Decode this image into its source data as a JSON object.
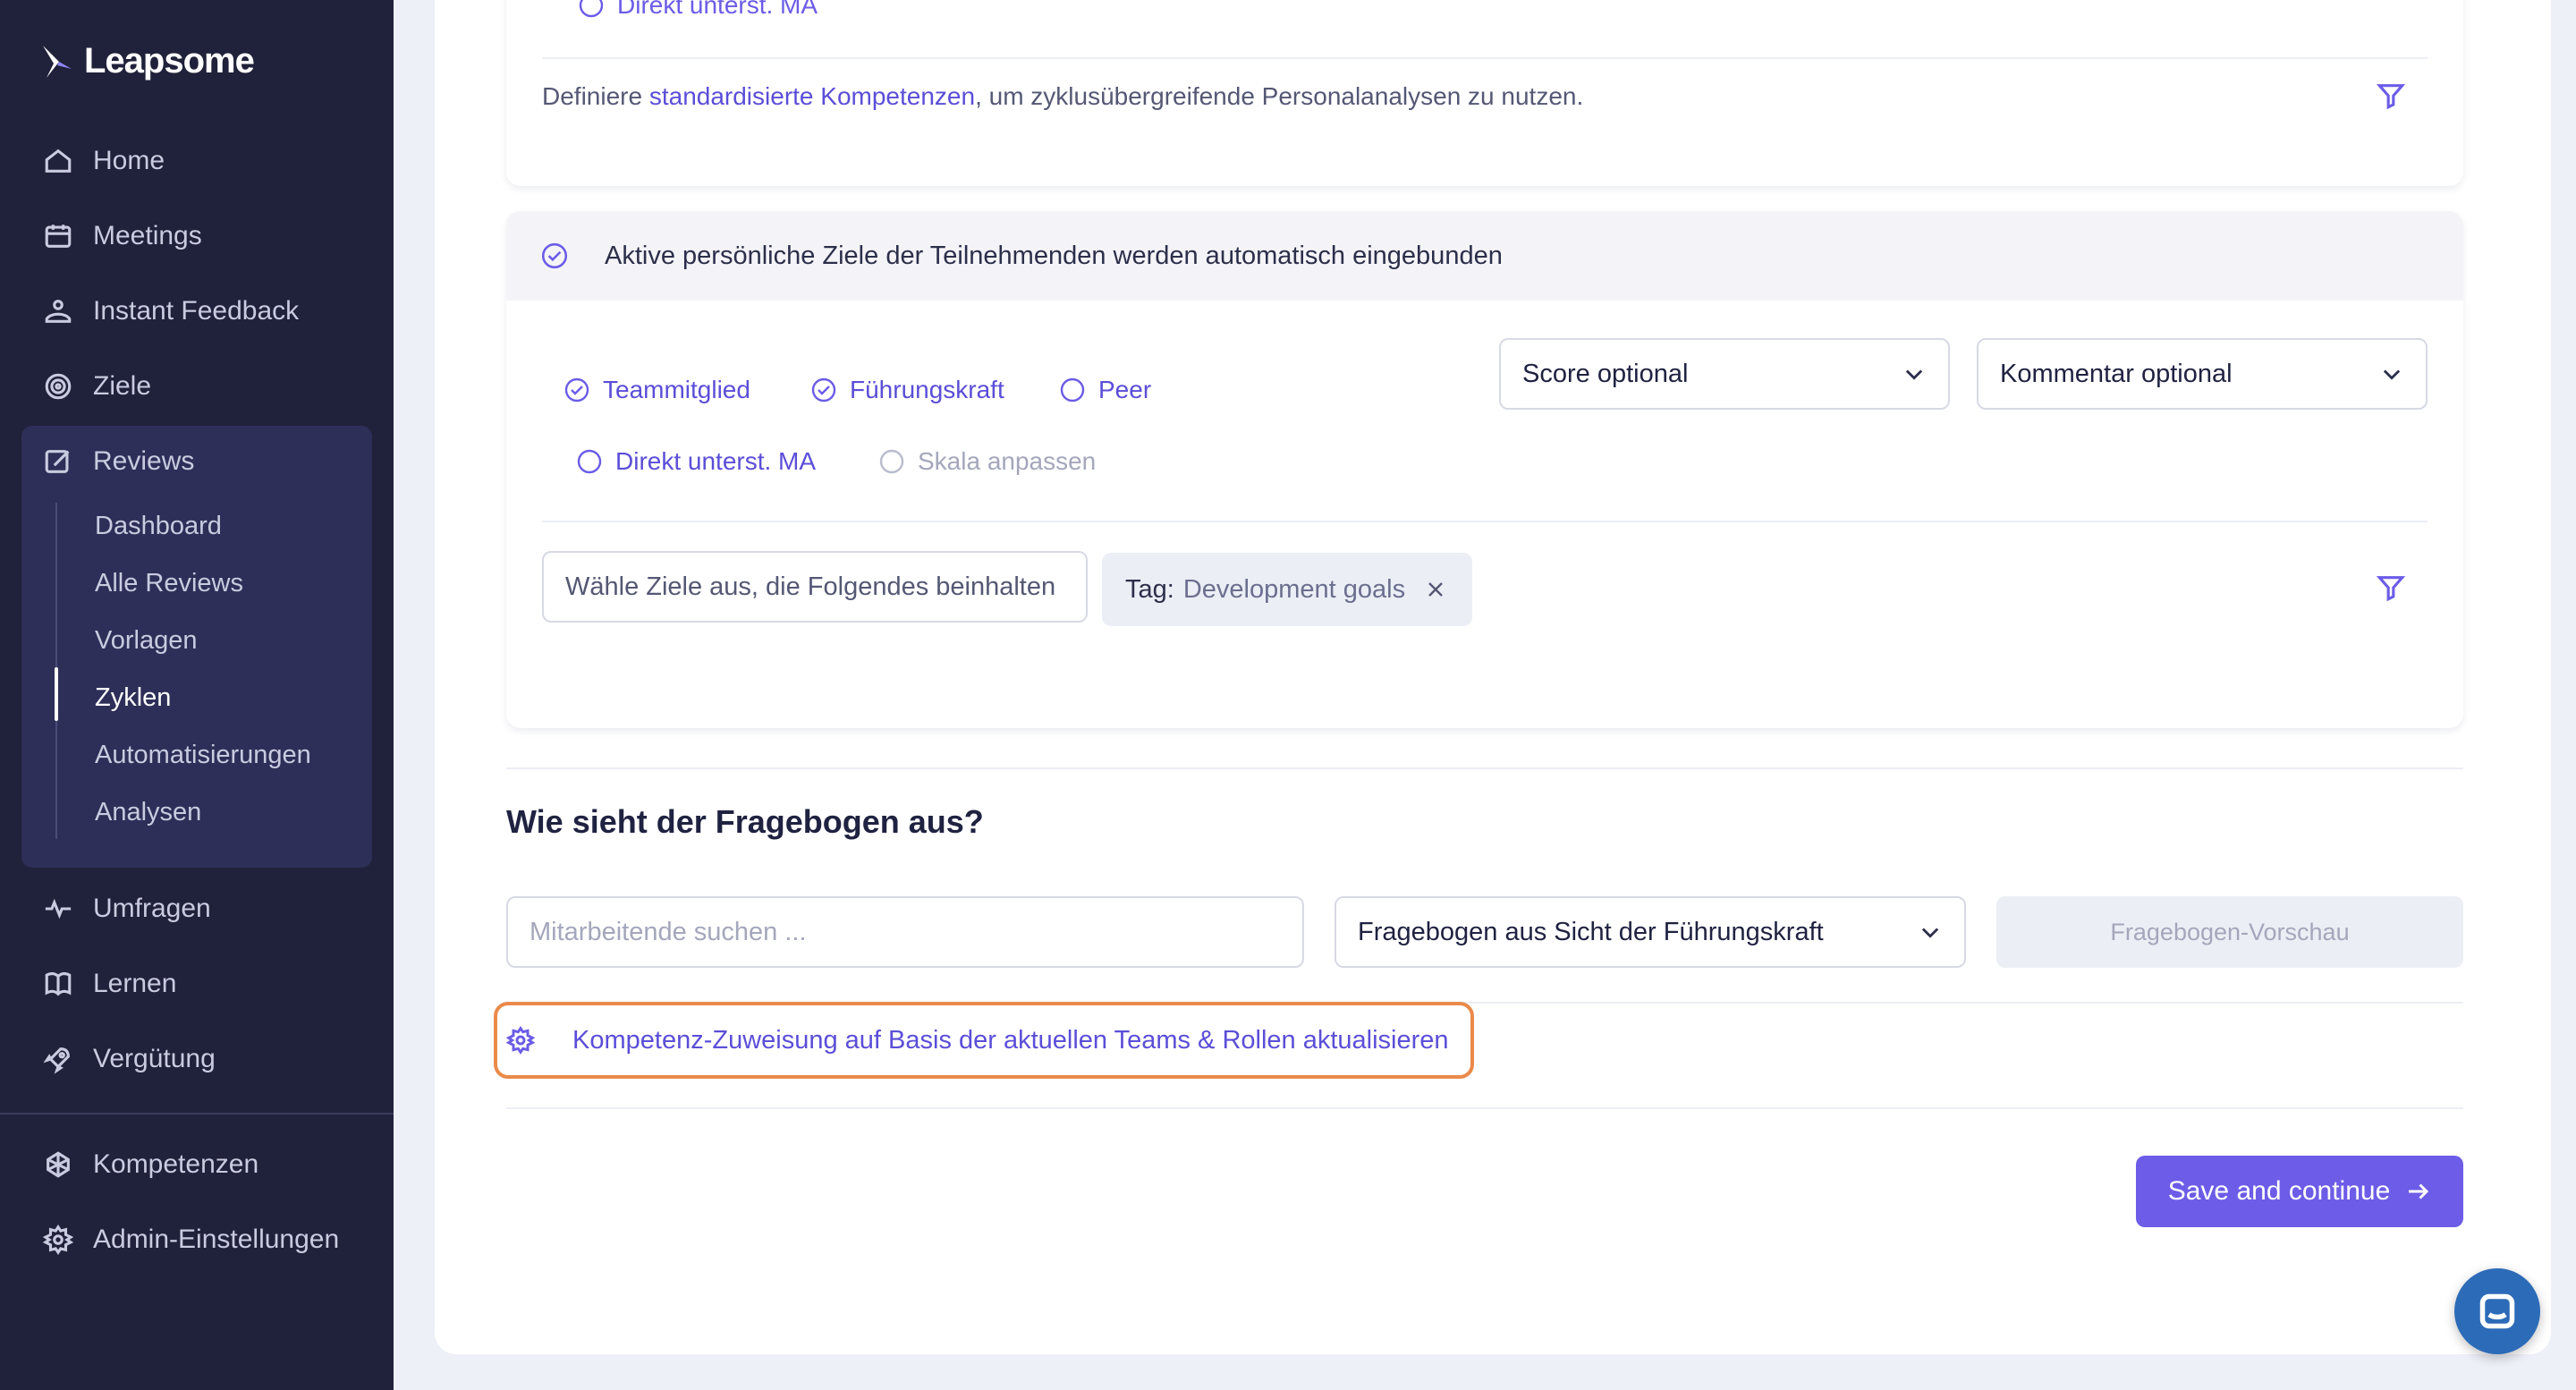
{
  "brand": {
    "name": "Leapsome",
    "accent": "#6c5ce7",
    "sidebar_bg": "#20213a"
  },
  "sidebar": {
    "items": [
      {
        "label": "Home",
        "icon": "home-icon"
      },
      {
        "label": "Meetings",
        "icon": "meetings-icon"
      },
      {
        "label": "Instant Feedback",
        "icon": "feedback-icon"
      },
      {
        "label": "Ziele",
        "icon": "target-icon"
      },
      {
        "label": "Reviews",
        "icon": "reviews-icon"
      },
      {
        "label": "Umfragen",
        "icon": "pulse-icon"
      },
      {
        "label": "Lernen",
        "icon": "book-icon"
      },
      {
        "label": "Vergütung",
        "icon": "rocket-icon"
      },
      {
        "label": "Kompetenzen",
        "icon": "competency-icon"
      },
      {
        "label": "Admin-Einstellungen",
        "icon": "gear-icon"
      }
    ],
    "reviews_sub": [
      {
        "label": "Dashboard"
      },
      {
        "label": "Alle Reviews"
      },
      {
        "label": "Vorlagen"
      },
      {
        "label": "Zyklen",
        "active": true
      },
      {
        "label": "Automatisierungen"
      },
      {
        "label": "Analysen"
      }
    ]
  },
  "competencies_card": {
    "faded_option": "Direkt unterst. MA",
    "define_prefix": "Definiere ",
    "define_link": "standardisierte Kompetenzen",
    "define_suffix": ", um zyklusübergreifende Personalanalysen zu nutzen."
  },
  "goals_card": {
    "header": "Aktive persönliche Ziele der Teilnehmenden werden automatisch eingebunden",
    "options": [
      {
        "label": "Teammitglied",
        "checked": true
      },
      {
        "label": "Führungskraft",
        "checked": true
      },
      {
        "label": "Peer",
        "checked": false
      },
      {
        "label": "Direkt unterst. MA",
        "checked": false
      },
      {
        "label": "Skala anpassen",
        "checked": false,
        "disabled": true
      }
    ],
    "score_select": "Score optional",
    "comment_select": "Kommentar optional",
    "filter_input": "Wähle Ziele aus, die Folgendes beinhalten",
    "tag_key": "Tag:",
    "tag_value": "Development goals"
  },
  "questionnaire": {
    "title": "Wie sieht der Fragebogen aus?",
    "search_placeholder": "Mitarbeitende suchen ...",
    "view_select": "Fragebogen aus Sicht der Führungskraft",
    "preview_button": "Fragebogen-Vorschau",
    "update_link": "Kompetenz-Zuweisung auf Basis der aktuellen Teams & Rollen aktualisieren"
  },
  "footer": {
    "save_button": "Save and continue"
  }
}
